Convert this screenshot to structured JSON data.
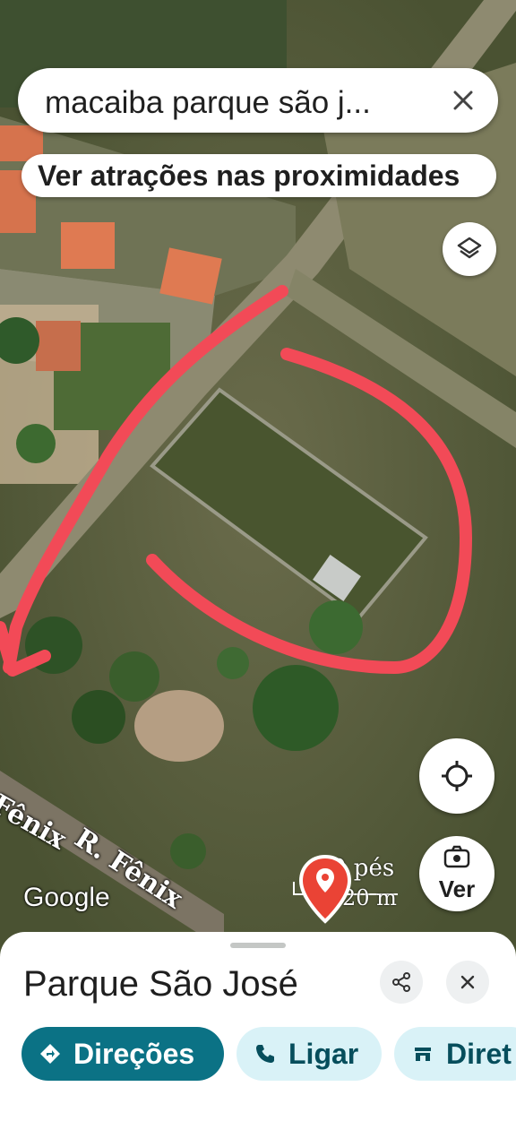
{
  "search": {
    "query": "macaiba parque são j...",
    "close_icon": "close-icon"
  },
  "nearby_chip": {
    "label": "Ver atrações nas proximidades"
  },
  "map": {
    "attribution": "Google",
    "street_labels": [
      "Fênix",
      "R. Fênix"
    ],
    "scale": {
      "imperial": "0 pés",
      "metric": "20 m"
    },
    "pin_icon": "place-pin-icon",
    "layers_icon": "layers-icon",
    "locate_icon": "my-location-icon",
    "annotation_color": "#f24a57"
  },
  "street_view_button": {
    "label": "Ver",
    "icon": "street-view-icon"
  },
  "place_sheet": {
    "title": "Parque São José",
    "share_icon": "share-icon",
    "close_icon": "close-icon",
    "actions": [
      {
        "label": "Direções",
        "icon": "directions-icon"
      },
      {
        "label": "Ligar",
        "icon": "phone-icon"
      },
      {
        "label": "Diret",
        "icon": "directory-icon"
      }
    ],
    "primary_color": "#0b7285",
    "chip_color": "#d9f2f7"
  }
}
